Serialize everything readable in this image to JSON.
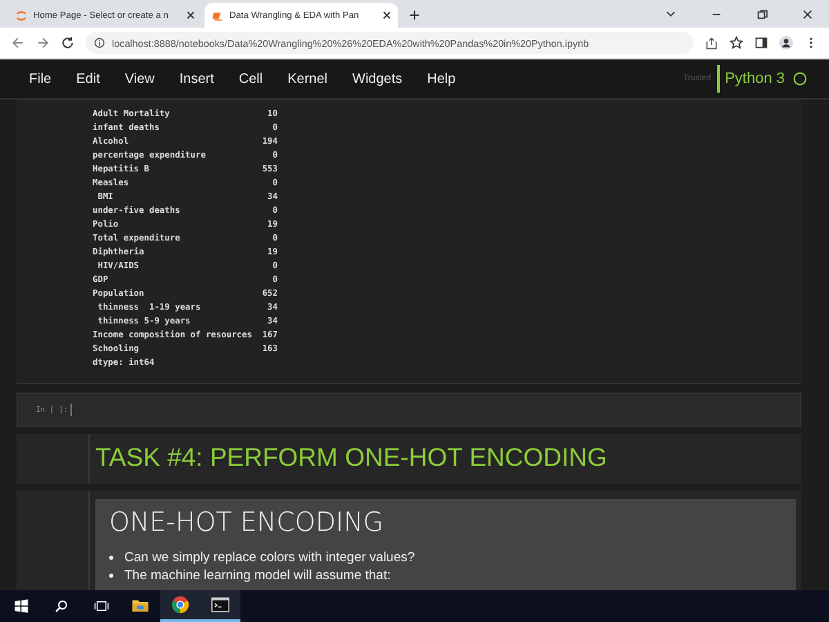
{
  "browser": {
    "tabs": [
      {
        "title": "Home Page - Select or create a n",
        "selected": false,
        "kind": "jupyter"
      },
      {
        "title": "Data Wrangling & EDA with Pan",
        "selected": true,
        "kind": "notebook"
      }
    ],
    "address": "localhost:8888/notebooks/Data%20Wrangling%20%26%20EDA%20with%20Pandas%20in%20Python.ipynb"
  },
  "menu": {
    "items": [
      "File",
      "Edit",
      "View",
      "Insert",
      "Cell",
      "Kernel",
      "Widgets",
      "Help"
    ],
    "trusted": "Trusted",
    "kernel": "Python 3"
  },
  "output": {
    "rows": [
      {
        "name": "Adult Mortality",
        "value": "10"
      },
      {
        "name": "infant deaths",
        "value": "0"
      },
      {
        "name": "Alcohol",
        "value": "194"
      },
      {
        "name": "percentage expenditure",
        "value": "0"
      },
      {
        "name": "Hepatitis B",
        "value": "553"
      },
      {
        "name": "Measles",
        "value": "0"
      },
      {
        "name": " BMI",
        "value": "34"
      },
      {
        "name": "under-five deaths",
        "value": "0"
      },
      {
        "name": "Polio",
        "value": "19"
      },
      {
        "name": "Total expenditure",
        "value": "0"
      },
      {
        "name": "Diphtheria",
        "value": "19"
      },
      {
        "name": " HIV/AIDS",
        "value": "0"
      },
      {
        "name": "GDP",
        "value": "0"
      },
      {
        "name": "Population",
        "value": "652"
      },
      {
        "name": " thinness  1-19 years",
        "value": "34"
      },
      {
        "name": " thinness 5-9 years",
        "value": "34"
      },
      {
        "name": "Income composition of resources",
        "value": "167"
      },
      {
        "name": "Schooling",
        "value": "163"
      }
    ],
    "dtype": "dtype: int64"
  },
  "input_cell": {
    "prompt": "In [ ]:"
  },
  "heading": "TASK #4: PERFORM ONE-HOT ENCODING",
  "slide": {
    "title": "ONE-HOT ENCODING",
    "bullets": [
      "Can we simply replace colors with integer values?",
      "The machine learning model will assume that:"
    ]
  },
  "taskbar": {
    "apps": [
      {
        "kind": "explorer",
        "active": false
      },
      {
        "kind": "chrome",
        "active": true
      },
      {
        "kind": "terminal",
        "active": true
      }
    ]
  }
}
